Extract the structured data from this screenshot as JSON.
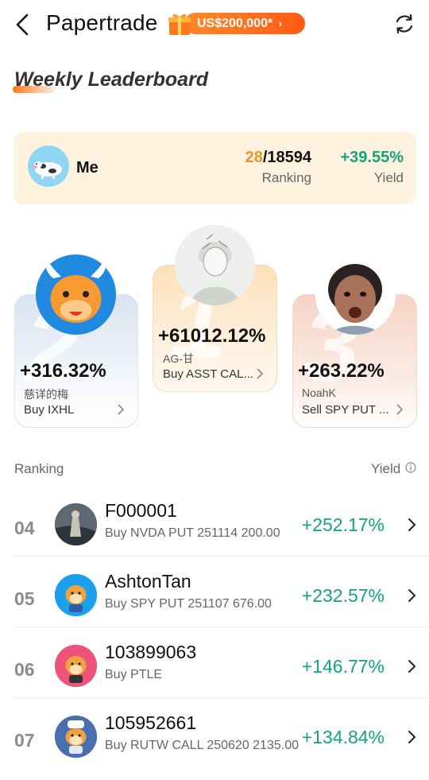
{
  "header": {
    "title": "Papertrade",
    "promo_label": "US$200,000*"
  },
  "leaderboard": {
    "title": "Weekly Leaderboard"
  },
  "me": {
    "name": "Me",
    "rank": "28",
    "total": "/18594",
    "rank_label": "Ranking",
    "yield": "+39.55%",
    "yield_label": "Yield"
  },
  "podium": [
    {
      "place": "2",
      "yield": "+316.32%",
      "name": "慈详的梅",
      "trade": "Buy IXHL"
    },
    {
      "place": "1",
      "yield": "+61012.12%",
      "name": "AG-甘",
      "trade": "Buy ASST CAL..."
    },
    {
      "place": "3",
      "yield": "+263.22%",
      "name": "NoahK",
      "trade": "Sell SPY PUT ..."
    }
  ],
  "list_header": {
    "ranking": "Ranking",
    "yield": "Yield"
  },
  "rows": [
    {
      "rank": "04",
      "name": "F000001",
      "trade": "Buy NVDA PUT 251114 200.00",
      "yield": "+252.17%"
    },
    {
      "rank": "05",
      "name": "AshtonTan",
      "trade": "Buy SPY PUT 251107 676.00",
      "yield": "+232.57%"
    },
    {
      "rank": "06",
      "name": "103899063",
      "trade": "Buy PTLE",
      "yield": "+146.77%"
    },
    {
      "rank": "07",
      "name": "105952661",
      "trade": "Buy RUTW CALL 250620 2135.00",
      "yield": "+134.84%"
    }
  ]
}
